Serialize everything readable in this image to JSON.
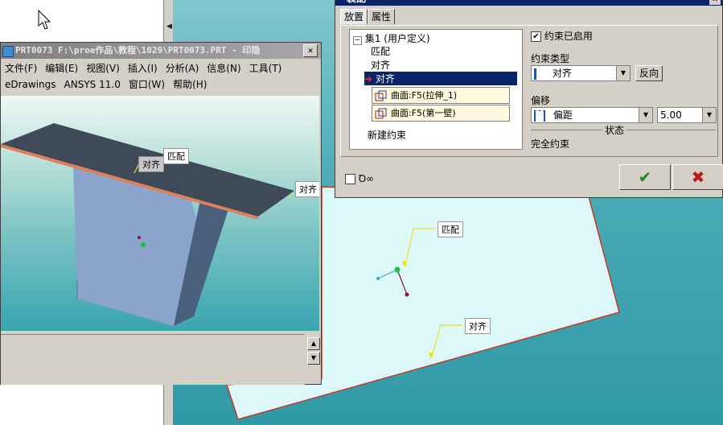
{
  "prt_window": {
    "title": "PRT0073 F:\\proe作品\\教程\\1029\\PRT0073.PRT - 印隐",
    "close": "✕",
    "menu1": [
      "文件(F)",
      "编辑(E)",
      "视图(V)",
      "插入(I)",
      "分析(A)",
      "信息(N)",
      "工具(T)"
    ],
    "menu2": [
      "eDrawings",
      "ANSYS 11.0",
      "窗口(W)",
      "帮助(H)"
    ],
    "labels": {
      "match": "匹配",
      "align1": "对齐",
      "align2": "对齐"
    }
  },
  "dialog": {
    "title": "装配",
    "close": "✕",
    "tabs": [
      "放置",
      "属性"
    ],
    "tree": {
      "set": "集1 (用户定义)",
      "match": "匹配",
      "align": "对齐",
      "selected": "对齐",
      "surf1": "曲面:F5(拉伸_1)",
      "surf2": "曲面:F5(第一壁)",
      "new_constraint": "新建约束"
    },
    "enabled_label": "约束已启用",
    "type_label": "约束类型",
    "type_value": "对齐",
    "flip": "反向",
    "offset_label": "偏移",
    "offset_value": "偏距",
    "offset_num": "5.00",
    "state_label": "状态",
    "state_value": "完全约束",
    "glasses": "Ꝺ∞",
    "ok": "✔",
    "cancel": "✖"
  },
  "background": {
    "label_match": "匹配",
    "label_align": "对齐"
  },
  "colors": {
    "dialog_title": "#0a246a",
    "ok_green": "#1e8a1e",
    "cancel_red": "#c01818"
  }
}
